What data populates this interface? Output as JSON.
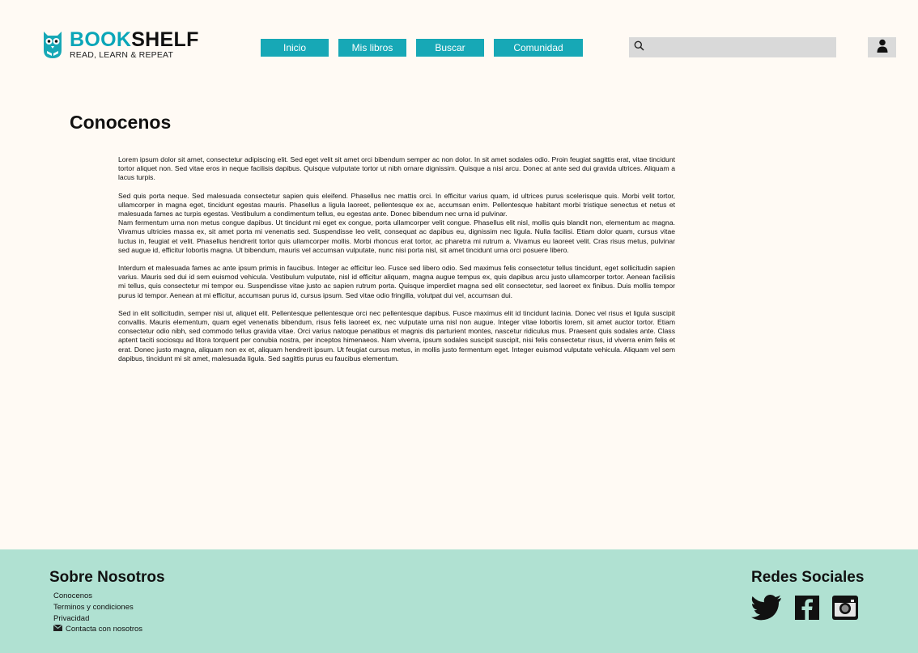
{
  "logo": {
    "brand_part1": "BOOK",
    "brand_part2": "SHELF",
    "tagline": "READ, LEARN & REPEAT"
  },
  "nav": {
    "items": [
      "Inicio",
      "Mis libros",
      "Buscar",
      "Comunidad"
    ]
  },
  "search": {
    "placeholder": ""
  },
  "page": {
    "title": "Conocenos",
    "paragraphs": [
      "Lorem ipsum dolor sit amet, consectetur adipiscing elit. Sed eget velit sit amet orci bibendum semper ac non dolor. In sit amet sodales odio. Proin feugiat sagittis erat, vitae tincidunt tortor aliquet non. Sed vitae eros in neque facilisis dapibus. Quisque vulputate tortor ut nibh ornare dignissim. Quisque a nisi arcu. Donec at ante sed dui gravida ultrices. Aliquam a lacus turpis.",
      "Sed quis porta neque. Sed malesuada consectetur sapien quis eleifend. Phasellus nec mattis orci. In efficitur varius quam, id ultrices purus scelerisque quis. Morbi velit tortor, ullamcorper in magna eget, tincidunt egestas mauris. Phasellus a ligula laoreet, pellentesque ex ac, accumsan enim. Pellentesque habitant morbi tristique senectus et netus et malesuada fames ac turpis egestas. Vestibulum a condimentum tellus, eu egestas ante. Donec bibendum nec urna id pulvinar.",
      "Nam fermentum urna non metus congue dapibus. Ut tincidunt mi eget ex congue, porta ullamcorper velit congue. Phasellus elit nisl, mollis quis blandit non, elementum ac magna. Vivamus ultricies massa ex, sit amet porta mi venenatis sed. Suspendisse leo velit, consequat ac dapibus eu, dignissim nec ligula. Nulla facilisi. Etiam dolor quam, cursus vitae luctus in, feugiat et velit. Phasellus hendrerit tortor quis ullamcorper mollis. Morbi rhoncus erat tortor, ac pharetra mi rutrum a. Vivamus eu laoreet velit. Cras risus metus, pulvinar sed augue id, efficitur lobortis magna. Ut bibendum, mauris vel accumsan vulputate, nunc nisi porta nisl, sit amet tincidunt urna orci posuere libero.",
      "Interdum et malesuada fames ac ante ipsum primis in faucibus. Integer ac efficitur leo. Fusce sed libero odio. Sed maximus felis consectetur tellus tincidunt, eget sollicitudin sapien varius. Mauris sed dui id sem euismod vehicula. Vestibulum vulputate, nisl id efficitur aliquam, magna augue tempus ex, quis dapibus arcu justo ullamcorper tortor. Aenean facilisis mi tellus, quis consectetur mi tempor eu. Suspendisse vitae justo ac sapien rutrum porta. Quisque imperdiet magna sed elit consectetur, sed laoreet ex finibus. Duis mollis tempor purus id tempor. Aenean at mi efficitur, accumsan purus id, cursus ipsum. Sed vitae odio fringilla, volutpat dui vel, accumsan dui.",
      "Sed in elit sollicitudin, semper nisi ut, aliquet elit. Pellentesque pellentesque orci nec pellentesque dapibus. Fusce maximus elit id tincidunt lacinia. Donec vel risus et ligula suscipit convallis. Mauris elementum, quam eget venenatis bibendum, risus felis laoreet ex, nec vulputate urna nisl non augue. Integer vitae lobortis lorem, sit amet auctor tortor. Etiam consectetur odio nibh, sed commodo tellus gravida vitae. Orci varius natoque penatibus et magnis dis parturient montes, nascetur ridiculus mus. Praesent quis sodales ante. Class aptent taciti sociosqu ad litora torquent per conubia nostra, per inceptos himenaeos. Nam viverra, ipsum sodales suscipit suscipit, nisi felis consectetur risus, id viverra enim felis et erat. Donec justo magna, aliquam non ex et, aliquam hendrerit ipsum. Ut feugiat cursus metus, in mollis justo fermentum eget. Integer euismod vulputate vehicula. Aliquam vel sem dapibus, tincidunt mi sit amet, malesuada ligula. Sed sagittis purus eu faucibus elementum."
    ]
  },
  "footer": {
    "about_title": "Sobre Nosotros",
    "links": [
      "Conocenos",
      "Terminos y condiciones",
      "Privacidad",
      "Contacta con nosotros"
    ],
    "social_title": "Redes Sociales",
    "social_icons": [
      "twitter-icon",
      "facebook-icon",
      "instagram-icon"
    ]
  },
  "colors": {
    "accent": "#17a8b6",
    "background": "#fffaf4",
    "footer": "#b0e1d2",
    "search_bg": "#d9d9d9"
  }
}
